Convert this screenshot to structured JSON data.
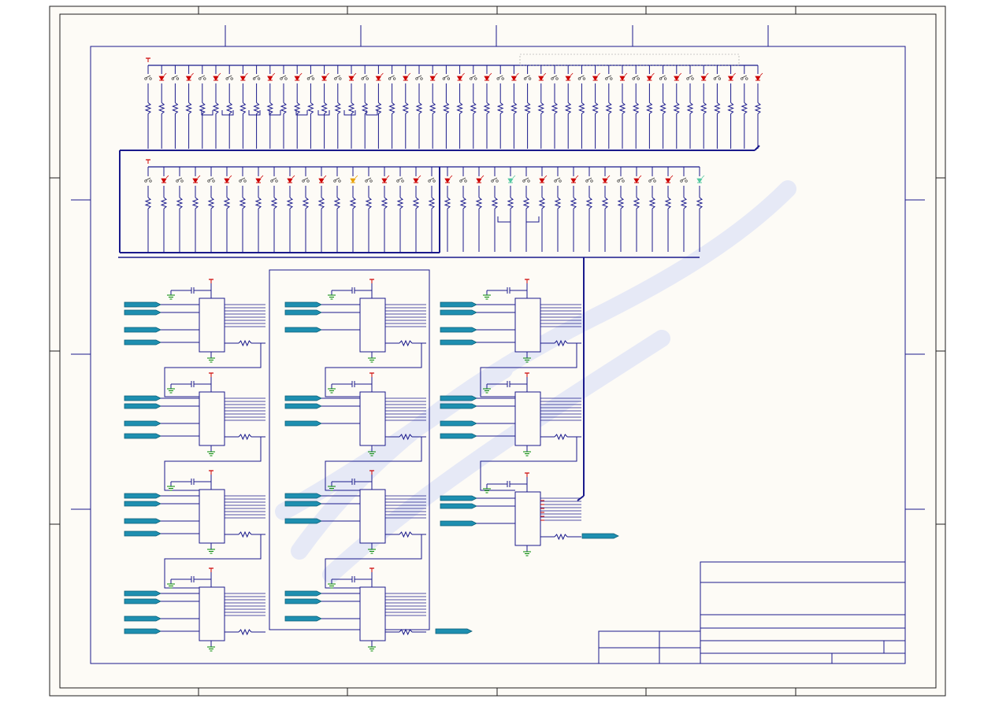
{
  "sheet": {
    "paper_color": "#fdfbf6",
    "frame_color": "#1e1e1e",
    "wire_color": "#1a1a8c",
    "bus_color": "#1a1a8c",
    "port_color": "#1e8fb0",
    "power_color": "#cc0000",
    "ground_color": "#008800",
    "led_colors": [
      "#cc0000",
      "#e8a000",
      "#55c8a0"
    ],
    "watermark_color": "#c9d2f7"
  },
  "zones": {
    "columns": [
      "",
      "",
      "",
      "",
      "",
      ""
    ],
    "rows": [
      "",
      "",
      "",
      ""
    ]
  },
  "title_block": {
    "title": "",
    "sheet_number": "",
    "revision": "",
    "date": "",
    "drawn_by": ""
  },
  "components": {
    "led_count_row_1": 46,
    "led_count_row_2": 36,
    "driver_ic_count": 11
  }
}
